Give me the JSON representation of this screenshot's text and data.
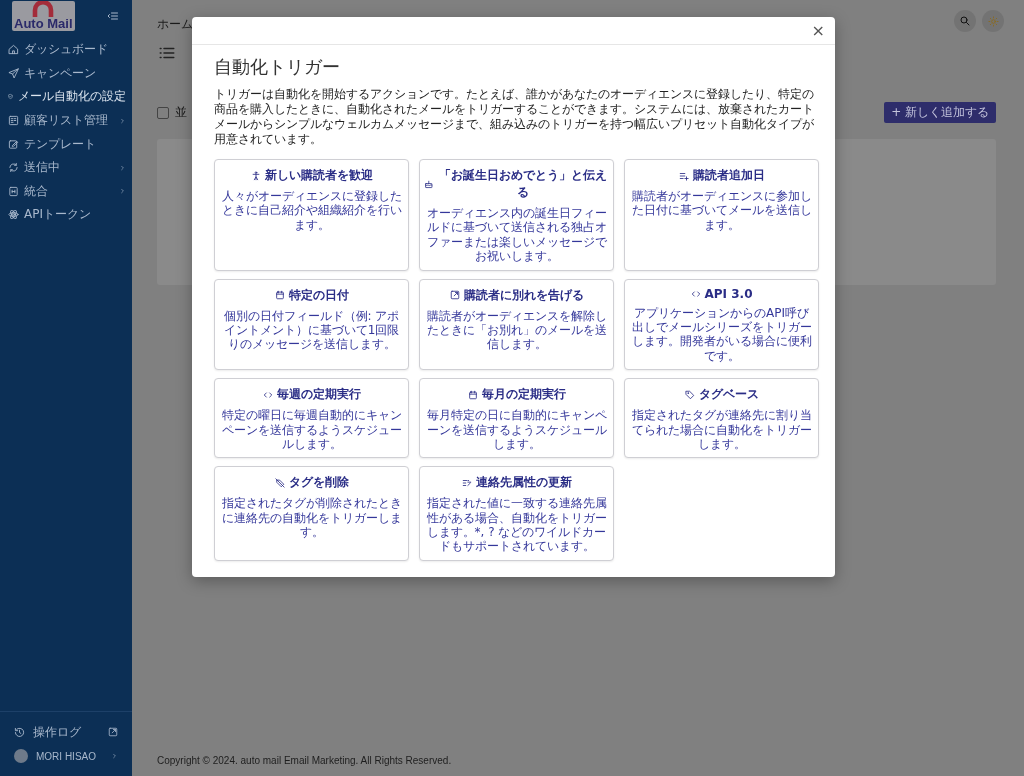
{
  "sidebar": {
    "logo": "Auto Mail",
    "items": [
      {
        "label": "ダッシュボード",
        "has_submenu": false,
        "selected": false
      },
      {
        "label": "キャンペーン",
        "has_submenu": false,
        "selected": false
      },
      {
        "label": "メール自動化の設定",
        "has_submenu": false,
        "selected": true
      },
      {
        "label": "顧客リスト管理",
        "has_submenu": true,
        "selected": false
      },
      {
        "label": "テンプレート",
        "has_submenu": false,
        "selected": false
      },
      {
        "label": "送信中",
        "has_submenu": true,
        "selected": false
      },
      {
        "label": "統合",
        "has_submenu": true,
        "selected": false
      },
      {
        "label": "APIトークン",
        "has_submenu": false,
        "selected": false
      }
    ],
    "log_item": "操作ログ",
    "user_name": "MORI HISAO"
  },
  "main": {
    "breadcrumb": "ホーム",
    "select_all": {
      "label": "並",
      "checked": false
    },
    "add_button": "+ 新しく追加する",
    "footer": "Copyright © 2024. auto mail Email Marketing. All Rights Reserved."
  },
  "modal": {
    "close": "×",
    "title": "自動化トリガー",
    "description": "トリガーは自動化を開始するアクションです。たとえば、誰かがあなたのオーディエンスに登録したり、特定の商品を購入したときに、自動化されたメールをトリガーすることができます。システムには、放棄されたカートメールからシンプルなウェルカムメッセージまで、組み込みのトリガーを持つ幅広いプリセット自動化タイプが用意されています。",
    "triggers": [
      {
        "title": "新しい購読者を歓迎",
        "description": "人々がオーディエンスに登録したときに自己紹介や組織紹介を行います。"
      },
      {
        "title": "「お誕生日おめでとう」と伝える",
        "description": "オーディエンス内の誕生日フィールドに基づいて送信される独占オファーまたは楽しいメッセージでお祝いします。"
      },
      {
        "title": "購読者追加日",
        "description": "購読者がオーディエンスに参加した日付に基づいてメールを送信します。"
      },
      {
        "title": "特定の日付",
        "description": "個別の日付フィールド（例: アポイントメント）に基づいて1回限りのメッセージを送信します。"
      },
      {
        "title": "購読者に別れを告げる",
        "description": "購読者がオーディエンスを解除したときに「お別れ」のメールを送信します。"
      },
      {
        "title": "API 3.0",
        "description": "アプリケーションからのAPI呼び出しでメールシリーズをトリガーします。開発者がいる場合に便利です。"
      },
      {
        "title": "毎週の定期実行",
        "description": "特定の曜日に毎週自動的にキャンペーンを送信するようスケジュールします。"
      },
      {
        "title": "毎月の定期実行",
        "description": "毎月特定の日に自動的にキャンペーンを送信するようスケジュールします。"
      },
      {
        "title": "タグベース",
        "description": "指定されたタグが連絡先に割り当てられた場合に自動化をトリガーします。"
      },
      {
        "title": "タグを削除",
        "description": "指定されたタグが削除されたときに連絡先の自動化をトリガーします。"
      },
      {
        "title": "連絡先属性の更新",
        "description": "指定された値に一致する連絡先属性がある場合、自動化をトリガーします。*, ? などのワイルドカードもサポートされています。"
      }
    ]
  }
}
